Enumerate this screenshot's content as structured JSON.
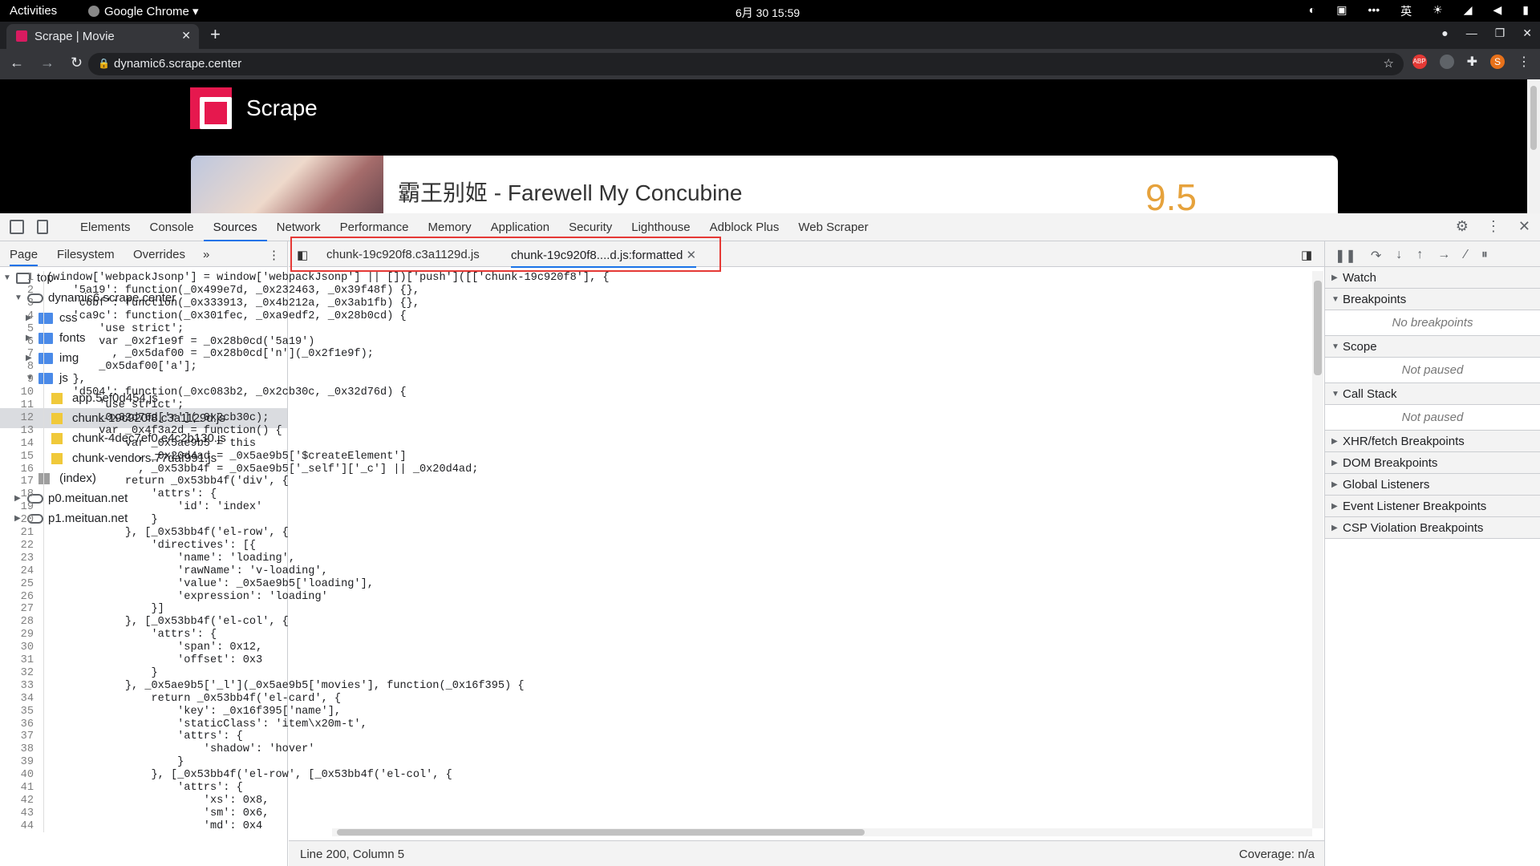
{
  "os": {
    "activities": "Activities",
    "app": "Google Chrome",
    "clock": "6月 30  15:59",
    "ime": "英"
  },
  "browser": {
    "tab_title": "Scrape | Movie",
    "url": "dynamic6.scrape.center",
    "abp": "ABP",
    "avatar": "S"
  },
  "site": {
    "brand": "Scrape",
    "movie_title": "霸王别姬 - Farewell My Concubine",
    "score": "9.5"
  },
  "devtools": {
    "tabs": [
      "Elements",
      "Console",
      "Sources",
      "Network",
      "Performance",
      "Memory",
      "Application",
      "Security",
      "Lighthouse",
      "Adblock Plus",
      "Web Scraper"
    ],
    "active_tab": "Sources",
    "nav_subtabs": [
      "Page",
      "Filesystem",
      "Overrides"
    ],
    "tree": [
      {
        "label": "top",
        "type": "frame",
        "depth": 0,
        "arrow": "▼"
      },
      {
        "label": "dynamic6.scrape.center",
        "type": "cloud",
        "depth": 1,
        "arrow": "▼"
      },
      {
        "label": "css",
        "type": "folder",
        "depth": 2,
        "arrow": "▶"
      },
      {
        "label": "fonts",
        "type": "folder",
        "depth": 2,
        "arrow": "▶"
      },
      {
        "label": "img",
        "type": "folder",
        "depth": 2,
        "arrow": "▶"
      },
      {
        "label": "js",
        "type": "folder",
        "depth": 2,
        "arrow": "▼"
      },
      {
        "label": "app.5ef0d454.js",
        "type": "js",
        "depth": 3,
        "arrow": ""
      },
      {
        "label": "chunk-19c920f8.c3a1129d.js",
        "type": "js",
        "depth": 3,
        "arrow": "",
        "selected": true
      },
      {
        "label": "chunk-4dec7ef0.e4c2b130.js",
        "type": "js",
        "depth": 3,
        "arrow": ""
      },
      {
        "label": "chunk-vendors.77daf991.js",
        "type": "js",
        "depth": 3,
        "arrow": ""
      },
      {
        "label": "(index)",
        "type": "page",
        "depth": 2,
        "arrow": ""
      },
      {
        "label": "p0.meituan.net",
        "type": "cloud",
        "depth": 1,
        "arrow": "▶"
      },
      {
        "label": "p1.meituan.net",
        "type": "cloud",
        "depth": 1,
        "arrow": "▶"
      }
    ],
    "editor_tabs": [
      "chunk-19c920f8.c3a1129d.js",
      "chunk-19c920f8....d.js:formatted"
    ],
    "code_lines": [
      "(window['webpackJsonp'] = window['webpackJsonp'] || [])['push']([['chunk-19c920f8'], {",
      "    '5a19': function(_0x499e7d, _0x232463, _0x39f48f) {},",
      "    'c6bf': function(_0x333913, _0x4b212a, _0x3ab1fb) {},",
      "    'ca9c': function(_0x301fec, _0xa9edf2, _0x28b0cd) {",
      "        'use strict';",
      "        var _0x2f1e9f = _0x28b0cd('5a19')",
      "          , _0x5daf00 = _0x28b0cd['n'](_0x2f1e9f);",
      "        _0x5daf00['a'];",
      "    },",
      "    'd504': function(_0xc083b2, _0x2cb30c, _0x32d76d) {",
      "        'use strict';",
      "        _0x32d76d['r'](_0x2cb30c);",
      "        var _0x4f3a2d = function() {",
      "            var _0x5ae9b5 = this",
      "              , _0x20d4ad = _0x5ae9b5['$createElement']",
      "              , _0x53bb4f = _0x5ae9b5['_self']['_c'] || _0x20d4ad;",
      "            return _0x53bb4f('div', {",
      "                'attrs': {",
      "                    'id': 'index'",
      "                }",
      "            }, [_0x53bb4f('el-row', {",
      "                'directives': [{",
      "                    'name': 'loading',",
      "                    'rawName': 'v-loading',",
      "                    'value': _0x5ae9b5['loading'],",
      "                    'expression': 'loading'",
      "                }]",
      "            }, [_0x53bb4f('el-col', {",
      "                'attrs': {",
      "                    'span': 0x12,",
      "                    'offset': 0x3",
      "                }",
      "            }, _0x5ae9b5['_l'](_0x5ae9b5['movies'], function(_0x16f395) {",
      "                return _0x53bb4f('el-card', {",
      "                    'key': _0x16f395['name'],",
      "                    'staticClass': 'item\\x20m-t',",
      "                    'attrs': {",
      "                        'shadow': 'hover'",
      "                    }",
      "                }, [_0x53bb4f('el-row', [_0x53bb4f('el-col', {",
      "                    'attrs': {",
      "                        'xs': 0x8,",
      "                        'sm': 0x6,",
      "                        'md': 0x4"
    ],
    "status_left": "Line 200, Column 5",
    "status_right": "Coverage: n/a",
    "debugger": {
      "watch": "Watch",
      "breakpoints": "Breakpoints",
      "no_breakpoints": "No breakpoints",
      "scope": "Scope",
      "not_paused_1": "Not paused",
      "call_stack": "Call Stack",
      "not_paused_2": "Not paused",
      "xhr": "XHR/fetch Breakpoints",
      "dom": "DOM Breakpoints",
      "global": "Global Listeners",
      "event": "Event Listener Breakpoints",
      "csp": "CSP Violation Breakpoints"
    }
  }
}
